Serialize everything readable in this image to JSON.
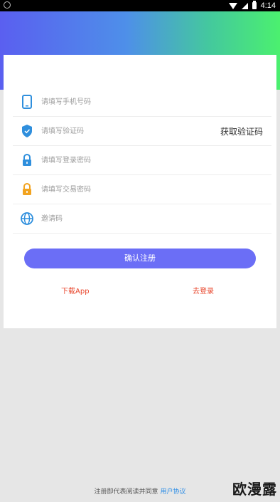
{
  "status_bar": {
    "time": "4:14"
  },
  "form": {
    "phone_placeholder": "请填写手机号码",
    "code_placeholder": "请填写验证码",
    "get_code_label": "获取验证码",
    "login_password_placeholder": "请填写登录密码",
    "trade_password_placeholder": "请填写交易密码",
    "invite_placeholder": "邀请码"
  },
  "actions": {
    "confirm_label": "确认注册",
    "download_label": "下载App",
    "login_label": "去登录"
  },
  "footer": {
    "text": "注册即代表阅读并同意",
    "agreement_label": "用户协议"
  },
  "watermark": "欧漫露",
  "colors": {
    "primary_button": "#6b6ef6",
    "link_red": "#e8442a",
    "agreement_blue": "#2a8ce6",
    "icon_blue": "#2f8fdd",
    "icon_orange": "#f2a31f"
  },
  "icons": [
    "phone-icon",
    "shield-icon",
    "lock-icon",
    "lock-icon",
    "globe-icon"
  ]
}
